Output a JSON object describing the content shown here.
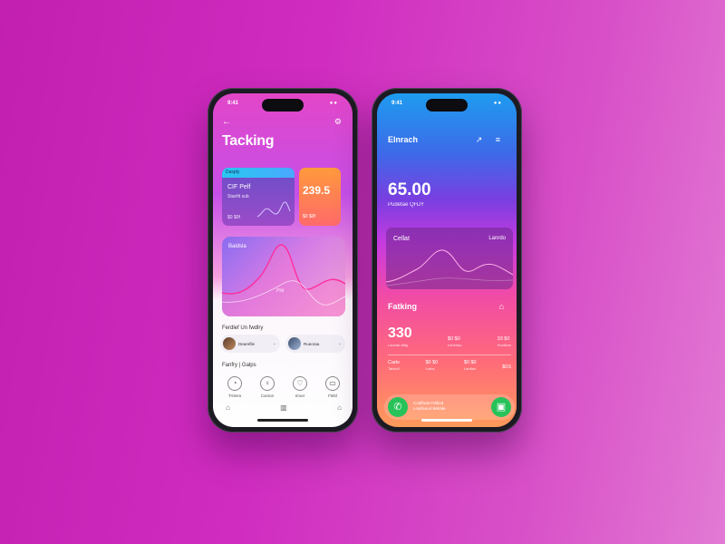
{
  "left_phone": {
    "status_time": "9:41",
    "status_right": "●●",
    "back_icon": "←",
    "share_icon": "⚙",
    "title": "Tacking",
    "card_a": {
      "header": "Dasply",
      "line1": "CIF Pelf",
      "line2": "Stanfit sub",
      "line3": "$0 $0f"
    },
    "card_b": {
      "amount": "239.5",
      "sub": "$0 $0f"
    },
    "wave_card": {
      "label": "Baidsla",
      "mid_label": "Plld"
    },
    "section1_title": "Ferdlef Un fwdlry",
    "contacts": [
      {
        "name": "Dearefile",
        "icon": "⌄"
      },
      {
        "name": "Rueoraa",
        "icon": "⌄"
      }
    ],
    "section2_title": "Fanfry | Galps",
    "icon_grid": [
      {
        "icon": "◔",
        "label": "Trnlera"
      },
      {
        "icon": "♀",
        "label": "Cacton"
      },
      {
        "icon": "♡",
        "label": "Irruer"
      },
      {
        "icon": "▭",
        "label": "Flebl"
      }
    ],
    "bottom_nav": [
      "⌂",
      "▥",
      "⌂"
    ]
  },
  "right_phone": {
    "status_time": "9:41",
    "status_right": "●●",
    "title": "Elnrach",
    "header_icons": "↗ ≡",
    "amount": "65.00",
    "amount_sub": "Pudetae QHJY",
    "chart_card": {
      "label": "Cellat",
      "label_right": "Lanrdo"
    },
    "section_title": "Fatking",
    "section_icon": "⌂",
    "stats_row1": [
      {
        "value": "330",
        "sub": "Lanntal dttig",
        "big": true
      },
      {
        "value": "$0 $0",
        "sub": "Leheirao"
      },
      {
        "value": "33 $0",
        "sub": "Hurdibre"
      }
    ],
    "stats_row2": [
      {
        "value": "Cads",
        "sub": "Tabtcdl"
      },
      {
        "value": "$0 $0",
        "sub": "Lrahs"
      },
      {
        "value": "$0 $0",
        "sub": "Lantlan"
      },
      {
        "value": "$0S",
        "sub": ""
      }
    ],
    "call_bar": {
      "line1": "Coaffuda Fddiod",
      "line2": "Loarhunot Belrale"
    }
  },
  "colors": {
    "background": "#d02cc0",
    "call_green": "#27c25a",
    "orange_card": "#ff9a3c",
    "cyan_strip": "#28c8f0"
  }
}
